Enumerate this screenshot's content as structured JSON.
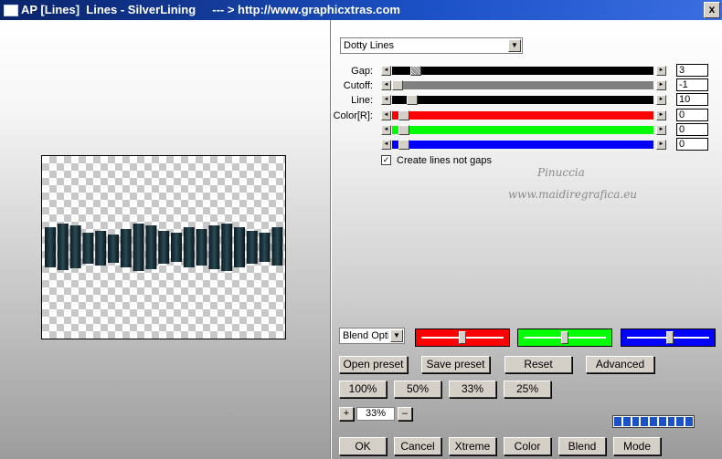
{
  "window": {
    "title": "AP [Lines]  Lines - SilverLining     --- > http://www.graphicxtras.com",
    "close_label": "x"
  },
  "effect_select": {
    "value": "Dotty Lines"
  },
  "params": [
    {
      "label": "Gap:",
      "value": "3"
    },
    {
      "label": "Cutoff:",
      "value": "-1"
    },
    {
      "label": "Line:",
      "value": "10"
    },
    {
      "label": "Color[R]:",
      "value": "0"
    },
    {
      "label": "",
      "value": "0"
    },
    {
      "label": "",
      "value": "0"
    }
  ],
  "checkbox": {
    "label": "Create lines not gaps",
    "checked": true,
    "mark": "✓"
  },
  "watermark": {
    "line1": "Pinuccia",
    "line2": "www.maidiregrafica.eu"
  },
  "blend_select": {
    "value": "Blend Optio"
  },
  "color_sliders": {
    "red": "#ff0000",
    "green": "#00ff00",
    "blue": "#0000ff"
  },
  "buttons": {
    "open_preset": "Open preset",
    "save_preset": "Save preset",
    "reset": "Reset",
    "advanced": "Advanced",
    "z100": "100%",
    "z50": "50%",
    "z33": "33%",
    "z25": "25%",
    "plus": "+",
    "minus": "–",
    "ok": "OK",
    "cancel": "Cancel",
    "xtreme": "Xtreme",
    "color": "Color",
    "blend": "Blend",
    "mode": "Mode"
  },
  "zoom": {
    "value": "33%"
  },
  "arrow_left": "◄",
  "arrow_right": "►",
  "arrow_down": "▼"
}
